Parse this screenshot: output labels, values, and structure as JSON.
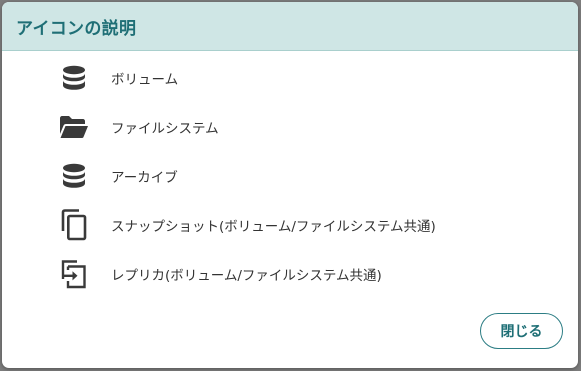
{
  "dialog": {
    "title": "アイコンの説明",
    "close_label": "閉じる",
    "items": [
      {
        "icon": "database-icon",
        "label": "ボリューム"
      },
      {
        "icon": "folder-open-icon",
        "label": "ファイルシステム"
      },
      {
        "icon": "database-icon",
        "label": "アーカイブ"
      },
      {
        "icon": "copy-icon",
        "label": "スナップショット(ボリューム/ファイルシステム共通)"
      },
      {
        "icon": "replica-icon",
        "label": "レプリカ(ボリューム/ファイルシステム共通)"
      }
    ]
  },
  "colors": {
    "header_bg": "#cfe6e5",
    "accent": "#1f6f76",
    "icon": "#3a3a3a"
  }
}
